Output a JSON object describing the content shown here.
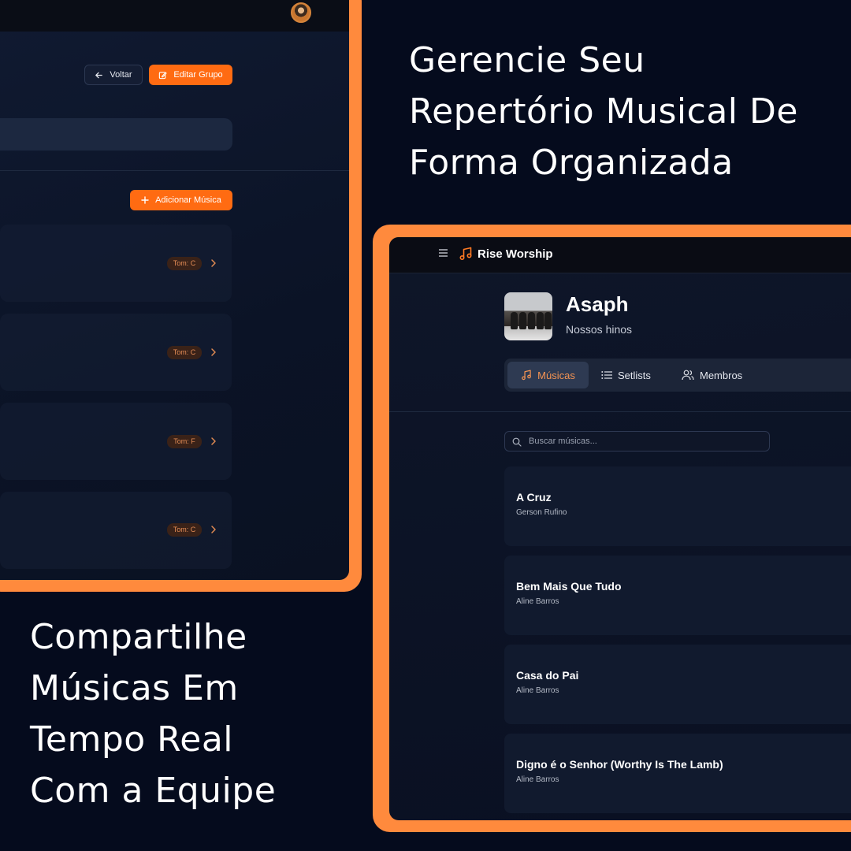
{
  "headlines": {
    "top": [
      "Gerencie Seu",
      "Repertório Musical De",
      "Forma Organizada"
    ],
    "bottom": [
      "Compartilhe",
      "Músicas Em",
      "Tempo Real",
      "Com a Equipe"
    ]
  },
  "left_screen": {
    "back_label": "Voltar",
    "edit_group_label": "Editar Grupo",
    "add_song_label": "Adicionar Música",
    "rows": [
      {
        "tom": "Tom: C"
      },
      {
        "tom": "Tom: C"
      },
      {
        "tom": "Tom: F"
      },
      {
        "tom": "Tom: C"
      }
    ]
  },
  "right_screen": {
    "app_name": "Rise Worship",
    "group": {
      "name": "Asaph",
      "description": "Nossos hinos"
    },
    "tabs": [
      {
        "label": "Músicas",
        "icon": "music-note-icon",
        "active": true
      },
      {
        "label": "Setlists",
        "icon": "list-icon",
        "active": false
      },
      {
        "label": "Membros",
        "icon": "users-icon",
        "active": false
      }
    ],
    "search": {
      "placeholder": "Buscar músicas..."
    },
    "songs": [
      {
        "title": "A Cruz",
        "artist": "Gerson Rufino"
      },
      {
        "title": "Bem Mais Que Tudo",
        "artist": "Aline Barros"
      },
      {
        "title": "Casa do Pai",
        "artist": "Aline Barros"
      },
      {
        "title": "Digno é o Senhor (Worthy Is The Lamb)",
        "artist": "Aline Barros"
      }
    ]
  },
  "colors": {
    "background": "#050b1d",
    "accent": "#ff6b12",
    "frame": "#ff8a3d",
    "badge_text": "#e58d56"
  }
}
